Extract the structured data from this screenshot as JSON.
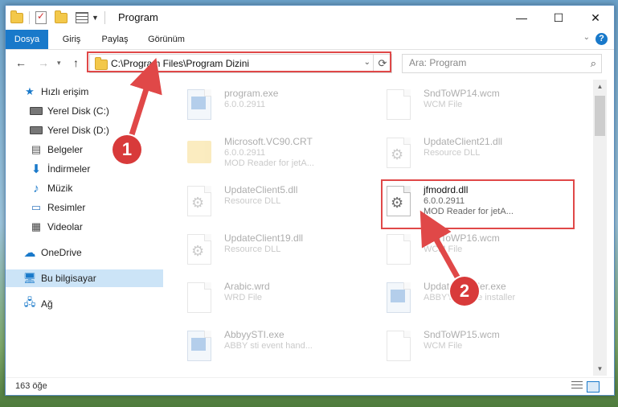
{
  "window": {
    "title": "Program",
    "controls": {
      "minimize": "—",
      "maximize": "☐",
      "close": "✕"
    }
  },
  "ribbon": {
    "tabs": [
      "Dosya",
      "Giriş",
      "Paylaş",
      "Görünüm"
    ],
    "help": "?"
  },
  "address": {
    "path": "C:\\Program Files\\Program Dizini"
  },
  "search": {
    "placeholder": "Ara: Program"
  },
  "sidebar": {
    "items": [
      {
        "label": "Hızlı erişim",
        "icon": "star-icon"
      },
      {
        "label": "Yerel Disk (C:)",
        "icon": "drive-icon",
        "pinned": true
      },
      {
        "label": "Yerel Disk (D:)",
        "icon": "drive-icon",
        "pinned": true
      },
      {
        "label": "Belgeler",
        "icon": "documents-icon",
        "pinned": true
      },
      {
        "label": "İndirmeler",
        "icon": "download-icon",
        "pinned": true
      },
      {
        "label": "Müzik",
        "icon": "music-icon",
        "pinned": true
      },
      {
        "label": "Resimler",
        "icon": "pictures-icon",
        "pinned": true
      },
      {
        "label": "Videolar",
        "icon": "videos-icon",
        "pinned": true
      },
      {
        "label": "OneDrive",
        "icon": "cloud-icon"
      },
      {
        "label": "Bu bilgisayar",
        "icon": "computer-icon",
        "selected": true
      },
      {
        "label": "Ağ",
        "icon": "network-icon"
      }
    ]
  },
  "files": [
    {
      "name": "program.exe",
      "line1": "6.0.0.2911",
      "line2": "",
      "type": "exe"
    },
    {
      "name": "SndToWP14.wcm",
      "line1": "WCM File",
      "line2": "",
      "type": "doc"
    },
    {
      "name": "Microsoft.VC90.CRT",
      "line1": "6.0.0.2911",
      "line2": "MOD Reader for jetA...",
      "type": "folder"
    },
    {
      "name": "UpdateClient21.dll",
      "line1": "Resource DLL",
      "line2": "",
      "type": "dll"
    },
    {
      "name": "UpdateClient5.dll",
      "line1": "Resource DLL",
      "line2": "",
      "type": "dll"
    },
    {
      "name": "jfmodrd.dll",
      "line1": "6.0.0.2911",
      "line2": "MOD Reader for jetA...",
      "type": "dll",
      "focus": true
    },
    {
      "name": "UpdateClient19.dll",
      "line1": "Resource DLL",
      "line2": "",
      "type": "dll"
    },
    {
      "name": "SndToWP16.wcm",
      "line1": "WCM File",
      "line2": "",
      "type": "doc"
    },
    {
      "name": "Arabic.wrd",
      "line1": "WRD File",
      "line2": "",
      "type": "doc"
    },
    {
      "name": "UpdateInstaller.exe",
      "line1": "ABBYY update installer",
      "line2": "",
      "type": "exe"
    },
    {
      "name": "AbbyySTI.exe",
      "line1": "ABBY sti event hand...",
      "line2": "",
      "type": "exe"
    },
    {
      "name": "SndToWP15.wcm",
      "line1": "WCM File",
      "line2": "",
      "type": "doc"
    }
  ],
  "status": {
    "count": "163 öğe"
  },
  "callouts": {
    "one": "1",
    "two": "2"
  },
  "colors": {
    "accent": "#1979ca",
    "highlight": "#e04848"
  }
}
